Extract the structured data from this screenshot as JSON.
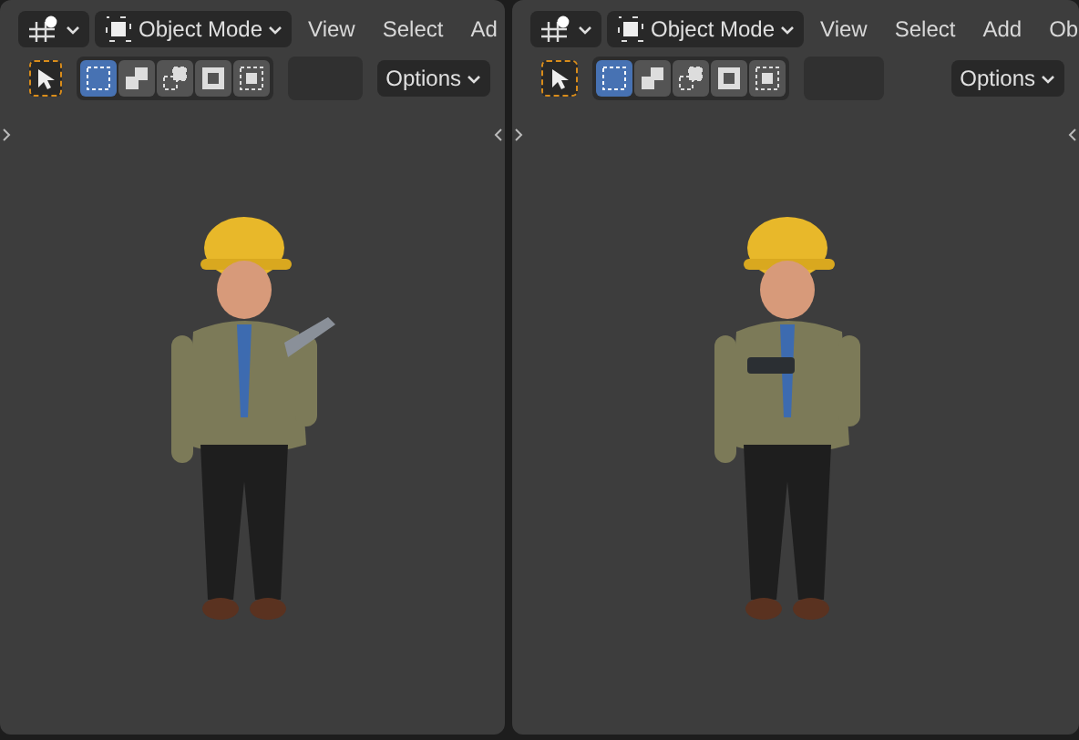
{
  "viewports": [
    {
      "mode": "Object Mode",
      "menus": [
        "View",
        "Select",
        "Ad"
      ],
      "tool_selected": true,
      "select_modes": [
        {
          "selected": true
        },
        {
          "selected": false
        },
        {
          "selected": false
        },
        {
          "selected": false
        },
        {
          "selected": false
        }
      ],
      "options": "Options",
      "kind": "clipboard"
    },
    {
      "mode": "Object Mode",
      "menus": [
        "View",
        "Select",
        "Add",
        "Ob"
      ],
      "tool_selected": true,
      "select_modes": [
        {
          "selected": true
        },
        {
          "selected": false
        },
        {
          "selected": false
        },
        {
          "selected": false
        },
        {
          "selected": false
        }
      ],
      "options": "Options",
      "kind": "tablet"
    }
  ]
}
